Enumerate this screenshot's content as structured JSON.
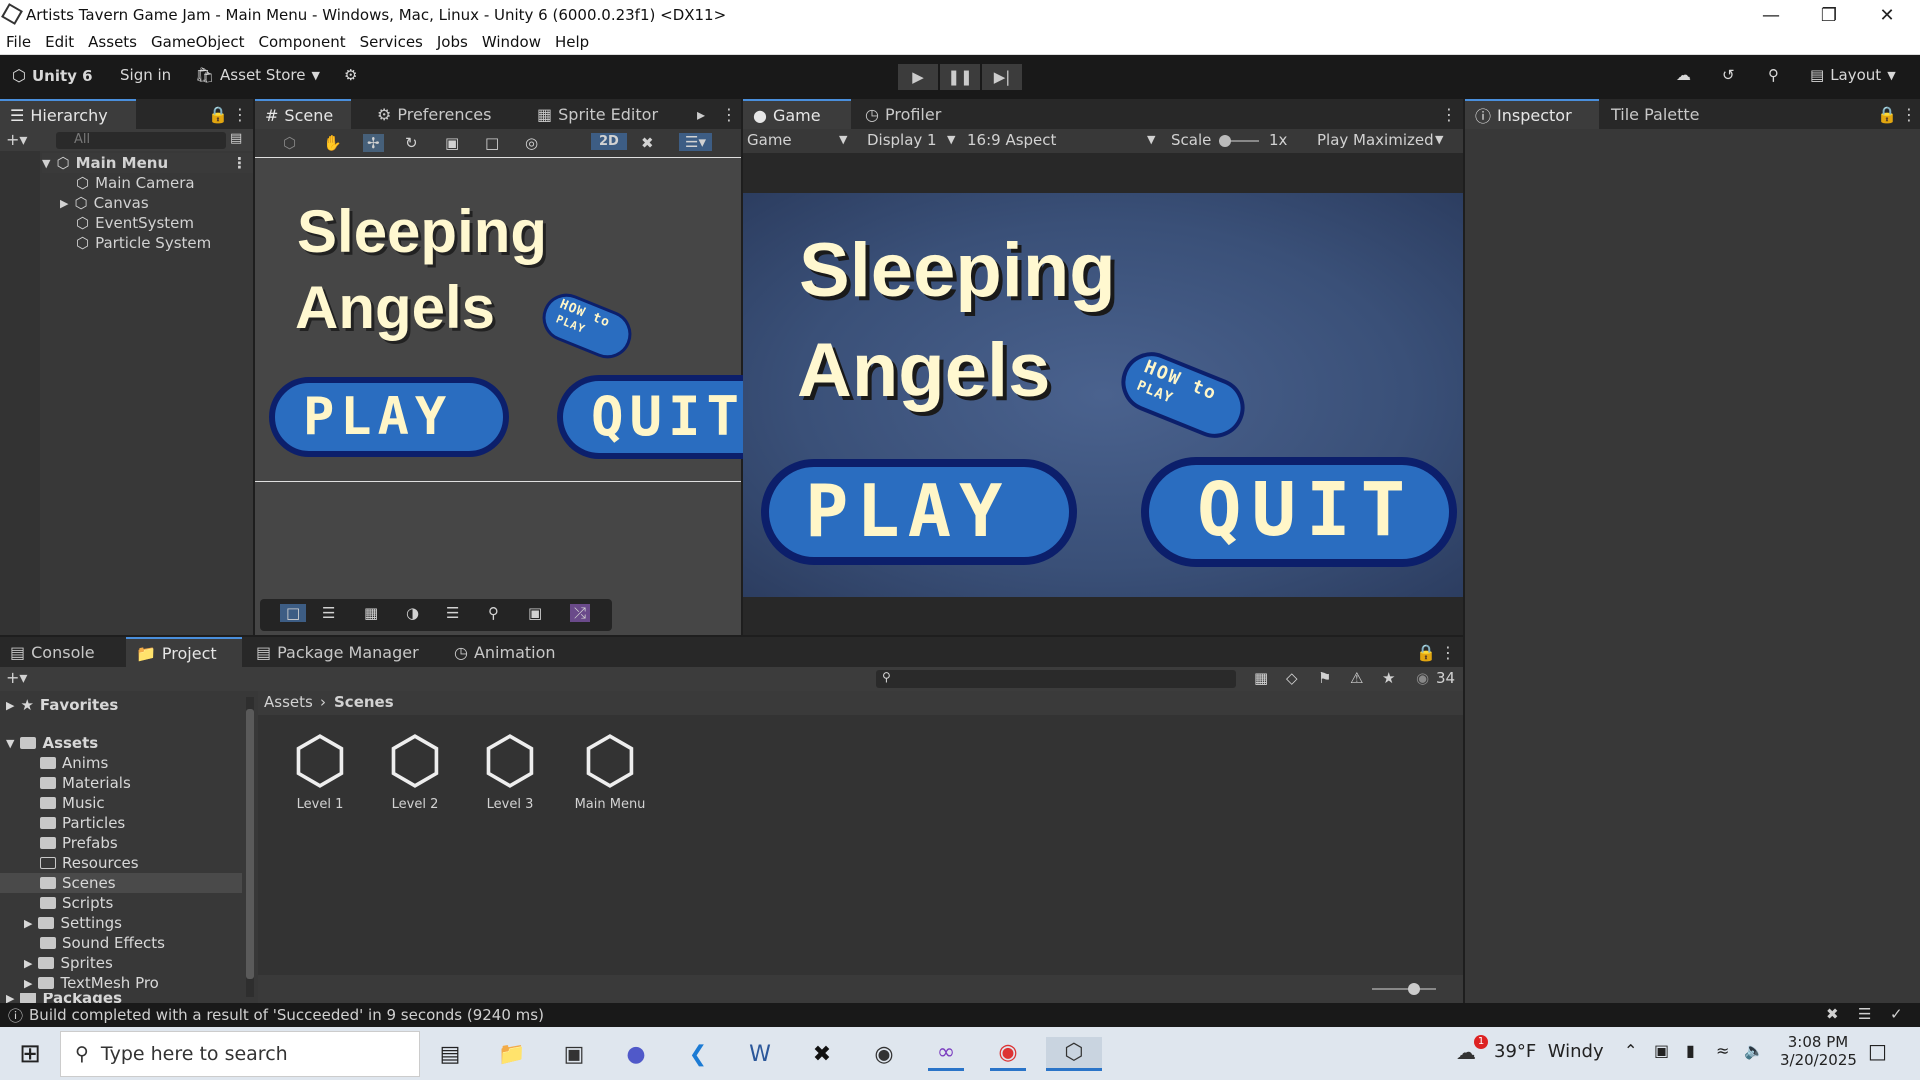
{
  "window": {
    "title": "Artists Tavern Game Jam - Main Menu - Windows, Mac, Linux - Unity 6 (6000.0.23f1) <DX11>"
  },
  "menu": [
    "File",
    "Edit",
    "Assets",
    "GameObject",
    "Component",
    "Services",
    "Jobs",
    "Window",
    "Help"
  ],
  "toolbar": {
    "account": "Unity 6",
    "signin": "Sign in",
    "asset_store": "Asset Store",
    "layout": "Layout"
  },
  "hierarchy": {
    "tab": "Hierarchy",
    "search_placeholder": "All",
    "scene": "Main Menu",
    "items": [
      "Main Camera",
      "Canvas",
      "EventSystem",
      "Particle System"
    ]
  },
  "scene_tabs": [
    "Scene",
    "Preferences",
    "Sprite Editor"
  ],
  "scene_toolbar": {
    "mode_2d": "2D"
  },
  "game": {
    "title_line1": "Sleeping",
    "title_line2": "Angels",
    "how_to": "HOW to",
    "play": "PLAY",
    "quit": "QUIT",
    "how_to_play": "PLAY"
  },
  "game_tabs": [
    "Game",
    "Profiler"
  ],
  "game_toolbar": {
    "view": "Game",
    "display": "Display 1",
    "aspect": "16:9 Aspect",
    "scale_label": "Scale",
    "scale_value": "1x",
    "play_mode": "Play Maximized"
  },
  "inspector_tabs": [
    "Inspector",
    "Tile Palette"
  ],
  "bottom_tabs": [
    "Console",
    "Project",
    "Package Manager",
    "Animation"
  ],
  "project": {
    "favorites": "Favorites",
    "assets": "Assets",
    "folders": [
      "Anims",
      "Materials",
      "Music",
      "Particles",
      "Prefabs",
      "Resources",
      "Scenes",
      "Scripts",
      "Settings",
      "Sound Effects",
      "Sprites",
      "TextMesh Pro"
    ],
    "packages": "Packages",
    "breadcrumb": [
      "Assets",
      "Scenes"
    ],
    "files": [
      "Level 1",
      "Level 2",
      "Level 3",
      "Main Menu"
    ],
    "hidden_count": "34"
  },
  "status": {
    "message": "Build completed with a result of 'Succeeded' in 9 seconds (9240 ms)"
  },
  "taskbar": {
    "search": "Type here to search",
    "weather": "39°F  Windy",
    "weather_badge": "1",
    "time": "3:08 PM",
    "date": "3/20/2025"
  },
  "colors": {
    "accent": "#4a8fdc",
    "game_bg": "#3a5078",
    "button_fill": "#2a6dc0",
    "button_border": "#0c1f6b",
    "title_text": "#fff8d0"
  }
}
